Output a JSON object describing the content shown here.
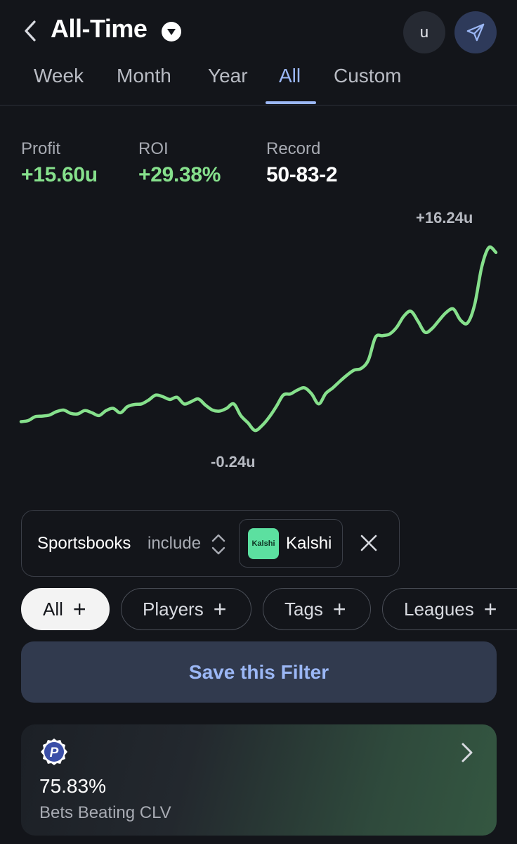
{
  "header": {
    "title": "All-Time",
    "user_initial": "u"
  },
  "tabs": [
    {
      "label": "Week"
    },
    {
      "label": "Month"
    },
    {
      "label": "Year"
    },
    {
      "label": "All"
    },
    {
      "label": "Custom"
    }
  ],
  "active_tab": "All",
  "stats": {
    "profit": {
      "label": "Profit",
      "value": "+15.60u"
    },
    "roi": {
      "label": "ROI",
      "value": "+29.38%"
    },
    "record": {
      "label": "Record",
      "value": "50-83-2"
    }
  },
  "chart_data": {
    "type": "line",
    "title": "",
    "xlabel": "",
    "ylabel": "",
    "color": "#86e08c",
    "max_label": "+16.24u",
    "min_label": "-0.24u",
    "ylim": [
      -0.24,
      16.24
    ],
    "values": [
      0.55,
      0.65,
      1.0,
      1.05,
      1.15,
      1.45,
      1.6,
      1.3,
      1.25,
      1.55,
      1.35,
      1.1,
      1.55,
      1.75,
      1.35,
      1.9,
      2.1,
      2.15,
      2.5,
      2.95,
      2.8,
      2.55,
      2.75,
      2.15,
      2.35,
      2.6,
      2.05,
      1.6,
      1.5,
      1.75,
      2.15,
      1.1,
      0.45,
      -0.24,
      0.2,
      0.95,
      1.9,
      2.95,
      3.05,
      3.4,
      3.6,
      3.05,
      2.15,
      3.1,
      3.6,
      4.2,
      4.75,
      5.2,
      5.35,
      6.1,
      8.15,
      8.3,
      8.45,
      9.05,
      10.05,
      10.5,
      9.6,
      8.6,
      8.95,
      9.7,
      10.4,
      10.7,
      9.7,
      9.45,
      11.1,
      14.5,
      16.24,
      15.8
    ]
  },
  "filter": {
    "field": "Sportsbooks",
    "operator": "include",
    "value_logo_text": "Kalshi",
    "value_label": "Kalshi"
  },
  "pills": [
    {
      "label": "All",
      "active": true
    },
    {
      "label": "Players",
      "active": false
    },
    {
      "label": "Tags",
      "active": false
    },
    {
      "label": "Leagues",
      "active": false
    }
  ],
  "save_button": "Save this Filter",
  "clv_card": {
    "badge_letter": "P",
    "value": "75.83%",
    "label": "Bets Beating CLV"
  },
  "colors": {
    "background": "#13151a",
    "accent": "#9bb7f5",
    "positive": "#86e08c"
  }
}
